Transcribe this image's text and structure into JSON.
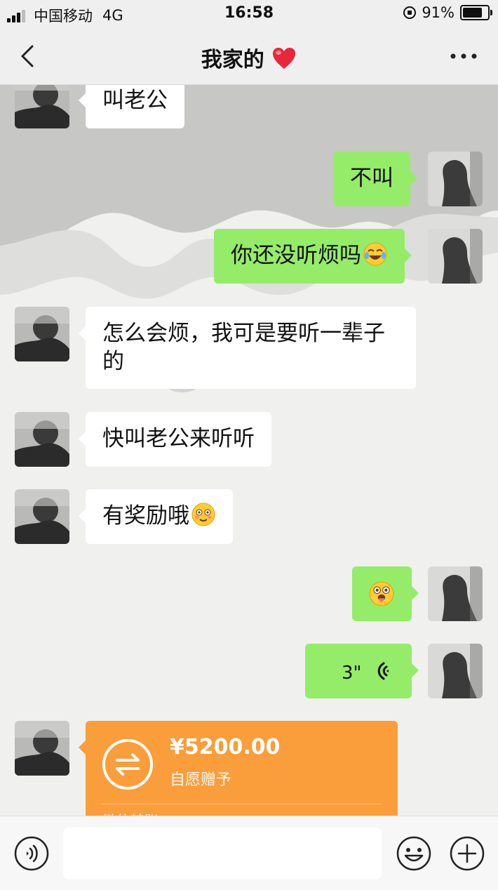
{
  "status_bar": {
    "carrier": "中国移动",
    "network": "4G",
    "time": "16:58",
    "battery": "91%",
    "battery_level": 0.91
  },
  "nav": {
    "title": "我家的",
    "title_emoji": "red-heart-icon"
  },
  "colors": {
    "bubble_out": "#95ec69",
    "bubble_in": "#ffffff",
    "transfer": "#fa9d3b",
    "background": "#efefef"
  },
  "messages": [
    {
      "side": "in",
      "text": "叫老公"
    },
    {
      "side": "out",
      "text": "不叫"
    },
    {
      "side": "out",
      "text": "你还没听烦吗",
      "emoji": "rofl-emoji"
    },
    {
      "side": "in",
      "text": "怎么会烦，我可是要听一辈子的"
    },
    {
      "side": "in",
      "text": "快叫老公来听听"
    },
    {
      "side": "in",
      "text": "有奖励哦",
      "emoji": "flushed-smile-emoji"
    },
    {
      "side": "out",
      "emoji": "tongue-out-emoji"
    },
    {
      "side": "out",
      "type": "voice",
      "duration": "3\""
    },
    {
      "side": "in",
      "type": "transfer",
      "amount": "¥5200.00",
      "note": "自愿赠予",
      "footer": "微信转账"
    }
  ],
  "input_bar": {
    "voice_icon": "voice-mode-icon",
    "emoji_icon": "emoji-icon",
    "plus_icon": "plus-icon"
  }
}
